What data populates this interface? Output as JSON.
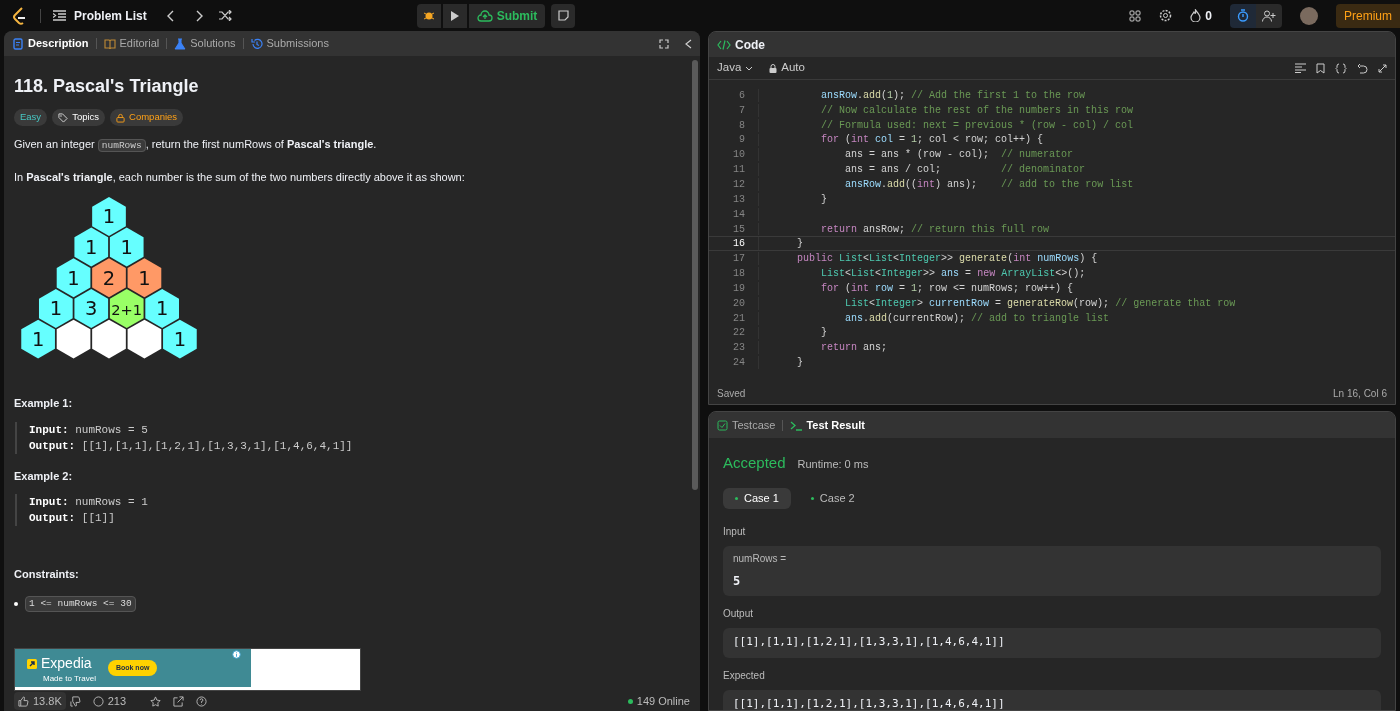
{
  "top_bar": {
    "problem_list": "Problem List",
    "submit": "Submit",
    "streak": "0",
    "premium": "Premium"
  },
  "description_panel": {
    "tabs": [
      {
        "label": "Description",
        "kind": "description",
        "selected": true
      },
      {
        "label": "Editorial",
        "kind": "editorial",
        "selected": false
      },
      {
        "label": "Solutions",
        "kind": "solutions",
        "selected": false
      },
      {
        "label": "Submissions",
        "kind": "submissions",
        "selected": false
      }
    ],
    "title": "118. Pascal's Triangle",
    "tags": [
      {
        "label": "Easy",
        "kind": "difficulty"
      },
      {
        "label": "Topics",
        "kind": "topics"
      },
      {
        "label": "Companies",
        "kind": "companies"
      }
    ],
    "paragraphs": [
      [
        {
          "kind": "text",
          "text": "Given an integer "
        },
        {
          "kind": "code",
          "text": "numRows"
        },
        {
          "kind": "text",
          "text": ", return the first numRows of **Pascal's triangle**."
        }
      ],
      [
        {
          "kind": "text",
          "text": "In **Pascal's triangle**, each number is the sum of the two numbers directly above it as shown:"
        }
      ]
    ],
    "figure": [
      [
        {
          "text": "1",
          "color": "#66ffff"
        }
      ],
      [
        {
          "text": "1",
          "color": "#66ffff"
        },
        {
          "text": "1",
          "color": "#66ffff"
        }
      ],
      [
        {
          "text": "1",
          "color": "#66ffff"
        },
        {
          "text": "2",
          "color": "#ff9966"
        },
        {
          "text": "1",
          "color": "#ff9966"
        }
      ],
      [
        {
          "text": "1",
          "color": "#66ffff"
        },
        {
          "text": "3",
          "color": "#66ffff"
        },
        {
          "text": "2+1",
          "color": "#99ff66"
        },
        {
          "text": "1",
          "color": "#66ffff"
        }
      ],
      [
        {
          "text": "1",
          "color": "#66ffff"
        },
        {
          "color": "#ffffff"
        },
        {
          "color": "#ffffff"
        },
        {
          "color": "#ffffff"
        },
        {
          "text": "1",
          "color": "#66ffff"
        }
      ]
    ],
    "examples": [
      {
        "title": "Example 1:",
        "lines": [
          {
            "label": "Input:",
            "value": "numRows = 5"
          },
          {
            "label": "Output:",
            "value": "[[1],[1,1],[1,2,1],[1,3,3,1],[1,4,6,4,1]]"
          }
        ]
      },
      {
        "title": "Example 2:",
        "lines": [
          {
            "label": "Input:",
            "value": "numRows = 1"
          },
          {
            "label": "Output:",
            "value": "[[1]]"
          }
        ]
      }
    ],
    "constraints": {
      "title": "Constraints:",
      "items": [
        "1 <= numRows <= 30"
      ]
    },
    "ad": {
      "brand": "Expedia",
      "tagline": "Made to Travel",
      "cta": "Book now"
    },
    "footer": {
      "likes": "13.8K",
      "comments": "213",
      "online": "149 Online"
    }
  },
  "code_panel": {
    "title": "Code",
    "language": "Java",
    "mode": "Auto",
    "lines": [
      {
        "number": "6",
        "active": false,
        "segments": [
          {
            "kind": "variable",
            "text": "        ansRow"
          },
          {
            "kind": "plain",
            "text": "."
          },
          {
            "kind": "function",
            "text": "add"
          },
          {
            "kind": "plain",
            "text": "("
          },
          {
            "kind": "number",
            "text": "1"
          },
          {
            "kind": "plain",
            "text": ");"
          },
          {
            "kind": "comment",
            "text": " // Add the first 1 to the row"
          }
        ]
      },
      {
        "number": "7",
        "active": false,
        "segments": [
          {
            "kind": "comment",
            "text": "        // Now calculate the rest of the numbers in this row"
          }
        ]
      },
      {
        "number": "8",
        "active": false,
        "segments": [
          {
            "kind": "comment",
            "text": "        // Formula used: next = previous * (row - col) / col"
          }
        ]
      },
      {
        "number": "9",
        "active": false,
        "segments": [
          {
            "kind": "keyword",
            "text": "        for"
          },
          {
            "kind": "plain",
            "text": " ("
          },
          {
            "kind": "keyword",
            "text": "int"
          },
          {
            "kind": "variable",
            "text": " col"
          },
          {
            "kind": "plain",
            "text": " = "
          },
          {
            "kind": "number",
            "text": "1"
          },
          {
            "kind": "plain",
            "text": "; col < row; col++) {"
          }
        ]
      },
      {
        "number": "10",
        "active": false,
        "segments": [
          {
            "kind": "plain",
            "text": "            ans = ans * (row - col);"
          },
          {
            "kind": "comment",
            "text": "  // numerator"
          }
        ]
      },
      {
        "number": "11",
        "active": false,
        "segments": [
          {
            "kind": "plain",
            "text": "            ans = ans / col;"
          },
          {
            "kind": "comment",
            "text": "          // denominator"
          }
        ]
      },
      {
        "number": "12",
        "active": false,
        "segments": [
          {
            "kind": "variable",
            "text": "            ansRow"
          },
          {
            "kind": "plain",
            "text": "."
          },
          {
            "kind": "function",
            "text": "add"
          },
          {
            "kind": "plain",
            "text": "(("
          },
          {
            "kind": "keyword",
            "text": "int"
          },
          {
            "kind": "plain",
            "text": ") ans);"
          },
          {
            "kind": "comment",
            "text": "    // add to the row list"
          }
        ]
      },
      {
        "number": "13",
        "active": false,
        "segments": [
          {
            "kind": "plain",
            "text": "        }"
          }
        ]
      },
      {
        "number": "14",
        "active": false
      },
      {
        "number": "15",
        "active": false,
        "segments": [
          {
            "kind": "keyword",
            "text": "        return"
          },
          {
            "kind": "plain",
            "text": " ansRow;"
          },
          {
            "kind": "comment",
            "text": " // return this full row"
          }
        ]
      },
      {
        "number": "16",
        "active": true,
        "segments": [
          {
            "kind": "plain",
            "text": "    }"
          }
        ]
      },
      {
        "number": "17",
        "active": false,
        "segments": [
          {
            "kind": "keyword",
            "text": "    public"
          },
          {
            "kind": "type",
            "text": " List"
          },
          {
            "kind": "plain",
            "text": "<"
          },
          {
            "kind": "type",
            "text": "List"
          },
          {
            "kind": "plain",
            "text": "<"
          },
          {
            "kind": "type",
            "text": "Integer"
          },
          {
            "kind": "plain",
            "text": ">>"
          },
          {
            "kind": "function",
            "text": " generate"
          },
          {
            "kind": "plain",
            "text": "("
          },
          {
            "kind": "keyword",
            "text": "int"
          },
          {
            "kind": "variable",
            "text": " numRows"
          },
          {
            "kind": "plain",
            "text": ") {"
          }
        ]
      },
      {
        "number": "18",
        "active": false,
        "segments": [
          {
            "kind": "type",
            "text": "        List"
          },
          {
            "kind": "plain",
            "text": "<"
          },
          {
            "kind": "type",
            "text": "List"
          },
          {
            "kind": "plain",
            "text": "<"
          },
          {
            "kind": "type",
            "text": "Integer"
          },
          {
            "kind": "plain",
            "text": ">>"
          },
          {
            "kind": "variable",
            "text": " ans"
          },
          {
            "kind": "plain",
            "text": " ="
          },
          {
            "kind": "keyword",
            "text": " new"
          },
          {
            "kind": "type",
            "text": " ArrayList"
          },
          {
            "kind": "plain",
            "text": "<>();"
          }
        ]
      },
      {
        "number": "19",
        "active": false,
        "segments": [
          {
            "kind": "keyword",
            "text": "        for"
          },
          {
            "kind": "plain",
            "text": " ("
          },
          {
            "kind": "keyword",
            "text": "int"
          },
          {
            "kind": "variable",
            "text": " row"
          },
          {
            "kind": "plain",
            "text": " = "
          },
          {
            "kind": "number",
            "text": "1"
          },
          {
            "kind": "plain",
            "text": "; row <= numRows; row++) {"
          }
        ]
      },
      {
        "number": "20",
        "active": false,
        "segments": [
          {
            "kind": "type",
            "text": "            List"
          },
          {
            "kind": "plain",
            "text": "<"
          },
          {
            "kind": "type",
            "text": "Integer"
          },
          {
            "kind": "plain",
            "text": ">"
          },
          {
            "kind": "variable",
            "text": " currentRow"
          },
          {
            "kind": "plain",
            "text": " ="
          },
          {
            "kind": "function",
            "text": " generateRow"
          },
          {
            "kind": "plain",
            "text": "(row);"
          },
          {
            "kind": "comment",
            "text": " // generate that row"
          }
        ]
      },
      {
        "number": "21",
        "active": false,
        "segments": [
          {
            "kind": "variable",
            "text": "            ans"
          },
          {
            "kind": "plain",
            "text": "."
          },
          {
            "kind": "function",
            "text": "add"
          },
          {
            "kind": "plain",
            "text": "(currentRow);"
          },
          {
            "kind": "comment",
            "text": " // add to triangle list"
          }
        ]
      },
      {
        "number": "22",
        "active": false,
        "segments": [
          {
            "kind": "plain",
            "text": "        }"
          }
        ]
      },
      {
        "number": "23",
        "active": false,
        "segments": [
          {
            "kind": "keyword",
            "text": "        return"
          },
          {
            "kind": "plain",
            "text": " ans;"
          }
        ]
      },
      {
        "number": "24",
        "active": false,
        "segments": [
          {
            "kind": "plain",
            "text": "    }"
          }
        ]
      }
    ],
    "status": "Saved",
    "cursor": "Ln 16, Col 6"
  },
  "test_panel": {
    "tabs": [
      {
        "label": "Testcase",
        "kind": "testcase",
        "selected": false
      },
      {
        "label": "Test Result",
        "kind": "result",
        "selected": true
      }
    ],
    "verdict": "Accepted",
    "runtime": "Runtime: 0 ms",
    "cases": [
      {
        "label": "Case 1",
        "selected": true
      },
      {
        "label": "Case 2",
        "selected": false
      }
    ],
    "input": {
      "label": "Input",
      "name": "numRows =",
      "value": "5"
    },
    "output": {
      "label": "Output",
      "value": "[[1],[1,1],[1,2,1],[1,3,3,1],[1,4,6,4,1]]"
    },
    "expected": {
      "label": "Expected",
      "value": "[[1],[1,1],[1,2,1],[1,3,3,1],[1,4,6,4,1]]"
    }
  }
}
